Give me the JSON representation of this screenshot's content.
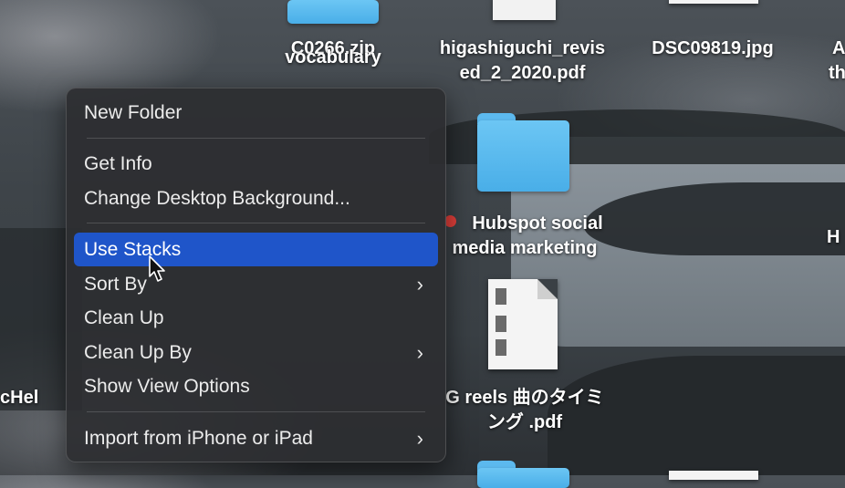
{
  "desktop": {
    "items": {
      "zip_label": "C0266.zip",
      "vocab_label": "vocabulary",
      "pdf1_label_line1": "higashiguchi_revis",
      "pdf1_label_line2": "ed_2_2020.pdf",
      "jpg_label": "DSC09819.jpg",
      "hubspot_label_line1": "Hubspot social",
      "hubspot_label_line2": "media marketing",
      "reels_label_line1": "G reels 曲のタイミ",
      "reels_label_line2": "ング .pdf",
      "edge_left_label": "cHel",
      "edge_right_a": "A",
      "edge_right_th": "th",
      "edge_right_h": "H"
    }
  },
  "context_menu": {
    "items": [
      {
        "label": "New Folder"
      },
      {
        "label": "Get Info"
      },
      {
        "label": "Change Desktop Background..."
      },
      {
        "label": "Use Stacks",
        "highlighted": true
      },
      {
        "label": "Sort By",
        "submenu": true
      },
      {
        "label": "Clean Up"
      },
      {
        "label": "Clean Up By",
        "submenu": true
      },
      {
        "label": "Show View Options"
      },
      {
        "label": "Import from iPhone or iPad",
        "submenu": true
      }
    ],
    "submenu_glyph": "›",
    "highlight_color": "#1f55c9"
  },
  "tag_color": "#e5403b"
}
